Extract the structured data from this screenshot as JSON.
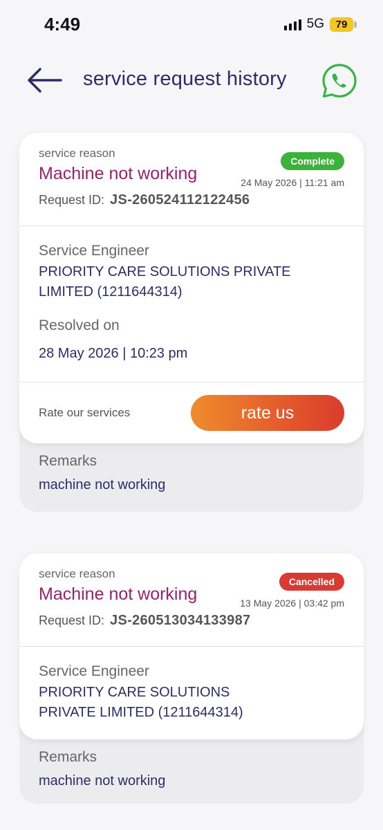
{
  "status_bar": {
    "time": "4:49",
    "network": "5G",
    "battery": "79"
  },
  "header": {
    "title": "service request history",
    "back_icon": "arrow-left-icon",
    "whatsapp_icon": "whatsapp-icon"
  },
  "colors": {
    "primary": "#2e2a6b",
    "reason": "#9c1f6f",
    "complete": "#3db23a",
    "cancelled": "#d93a33",
    "whatsapp": "#35b44a"
  },
  "requests": [
    {
      "reason_label": "service reason",
      "reason": "Machine not working",
      "status": "Complete",
      "date": "24 May 2026 | 11:21 am",
      "request_id_label": "Request ID:",
      "request_id": "JS-260524112122456",
      "engineer_label": "Service Engineer",
      "engineer": "PRIORITY CARE SOLUTIONS PRIVATE LIMITED (1211644314)",
      "resolved_label": "Resolved on",
      "resolved": "28 May 2026 | 10:23 pm",
      "rate_label": "Rate our services",
      "rate_button": "rate us",
      "remarks_label": "Remarks",
      "remarks": "machine not working"
    },
    {
      "reason_label": "service reason",
      "reason": "Machine not working",
      "status": "Cancelled",
      "date": "13 May 2026 | 03:42 pm",
      "request_id_label": "Request ID:",
      "request_id": "JS-260513034133987",
      "engineer_label": "Service Engineer",
      "engineer": "PRIORITY CARE SOLUTIONS PRIVATE LIMITED (1211644314)",
      "remarks_label": "Remarks",
      "remarks": "machine not working"
    }
  ]
}
